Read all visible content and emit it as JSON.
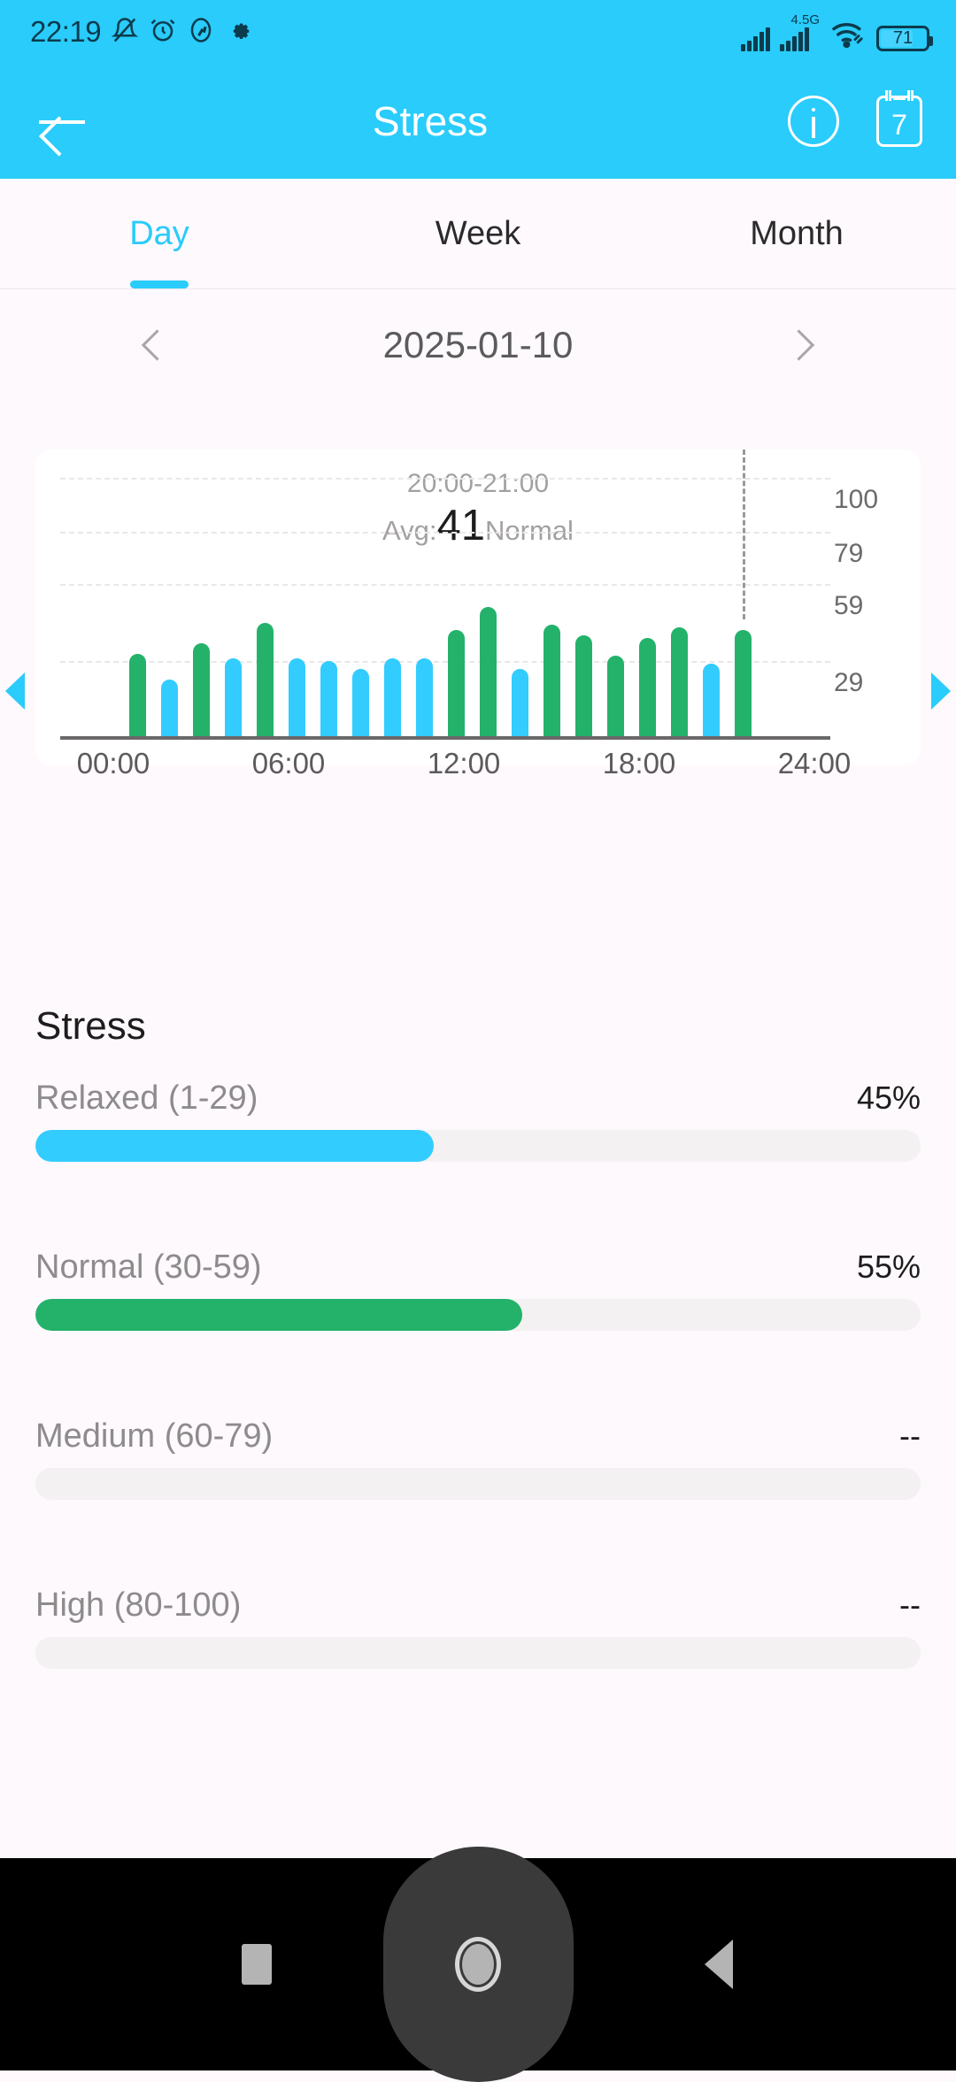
{
  "status_bar": {
    "clock": "22:19",
    "left_icons": [
      "bell-muted-icon",
      "alarm-icon",
      "activity-icon",
      "gear-icon"
    ],
    "network_label": "4.5G",
    "battery_level": "71",
    "battery_percent": 71
  },
  "app_bar": {
    "title": "Stress",
    "back_icon": "back-arrow-icon",
    "info_icon": "info-icon",
    "calendar_icon": "calendar-icon",
    "calendar_number": "7"
  },
  "tabs": [
    {
      "label": "Day",
      "active": true
    },
    {
      "label": "Week",
      "active": false
    },
    {
      "label": "Month",
      "active": false
    }
  ],
  "date_nav": {
    "prev_icon": "chevron-left-icon",
    "next_icon": "chevron-right-icon",
    "date": "2025-01-10"
  },
  "card": {
    "time_range": "20:00-21:00",
    "avg_prefix": "Avg:",
    "avg_value": "41",
    "avg_status": "Normal",
    "left_arrow_icon": "triangle-left-icon",
    "right_arrow_icon": "triangle-right-icon"
  },
  "section": {
    "title": "Stress"
  },
  "levels": [
    {
      "name": "Relaxed (1-29)",
      "percent_label": "45%",
      "percent": 45,
      "color": "#33ccff"
    },
    {
      "name": "Normal (30-59)",
      "percent_label": "55%",
      "percent": 55,
      "color": "#24b26b"
    },
    {
      "name": "Medium (60-79)",
      "percent_label": "--",
      "percent": 0,
      "color": "#f5a623"
    },
    {
      "name": "High (80-100)",
      "percent_label": "--",
      "percent": 0,
      "color": "#e8563f"
    }
  ],
  "nav_bar": {
    "recents_icon": "square-recents-icon",
    "home_icon": "circle-home-icon",
    "back_icon": "triangle-back-icon"
  },
  "chart_data": {
    "type": "bar",
    "title": "Daily stress level",
    "xlabel": "",
    "ylabel": "",
    "ylim": [
      0,
      100
    ],
    "yticks": [
      29,
      59,
      79,
      100
    ],
    "ytick_labels": [
      "29",
      "59",
      "79",
      "100"
    ],
    "xticks": [
      "00:00",
      "06:00",
      "12:00",
      "18:00",
      "24:00"
    ],
    "grid": true,
    "legend": false,
    "selected_index": 21,
    "selection_marker": "dashed-vertical-line",
    "colors": {
      "relaxed": "#33ccff",
      "normal": "#24b26b"
    },
    "series": [
      {
        "name": "Stress",
        "values": [
          32,
          22,
          36,
          30,
          44,
          30,
          29,
          26,
          30,
          30,
          41,
          50,
          26,
          43,
          39,
          31,
          38,
          42,
          28,
          41
        ],
        "categories": [
          "00:30",
          "01:30",
          "02:30",
          "03:30",
          "04:30",
          "05:30",
          "06:30",
          "07:30",
          "08:30",
          "09:30",
          "10:30",
          "11:30",
          "12:30",
          "13:30",
          "14:30",
          "15:30",
          "16:30",
          "17:30",
          "18:30",
          "20:30"
        ],
        "bar_colors": [
          "normal",
          "relaxed",
          "normal",
          "relaxed",
          "normal",
          "relaxed",
          "relaxed",
          "relaxed",
          "relaxed",
          "relaxed",
          "normal",
          "normal",
          "relaxed",
          "normal",
          "normal",
          "normal",
          "normal",
          "normal",
          "relaxed",
          "normal"
        ]
      }
    ]
  }
}
